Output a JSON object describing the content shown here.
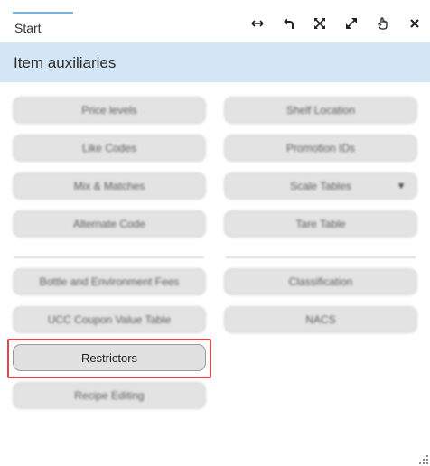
{
  "tab": {
    "label": "Start"
  },
  "toolbar": {
    "icons": [
      "resize-horizontal-icon",
      "undo-icon",
      "fit-screen-icon",
      "expand-icon",
      "pointer-hand-icon",
      "close-icon"
    ]
  },
  "header": {
    "title": "Item auxiliaries"
  },
  "buttons": {
    "price_levels": "Price levels",
    "shelf_location": "Shelf Location",
    "like_codes": "Like Codes",
    "promotion_ids": "Promotion IDs",
    "mix_matches": "Mix & Matches",
    "scale_tables": "Scale Tables",
    "alternate_code": "Alternate Code",
    "tare_table": "Tare Table",
    "bottle_fees": "Bottle and Environment Fees",
    "classification": "Classification",
    "ucc_coupon": "UCC Coupon Value Table",
    "nacs": "NACS",
    "restrictors": "Restrictors",
    "recipe_editing": "Recipe Editing"
  },
  "colors": {
    "header_bg": "#d3e6f5",
    "tab_accent": "#7fb0da",
    "focus_ring": "#e0474d"
  }
}
